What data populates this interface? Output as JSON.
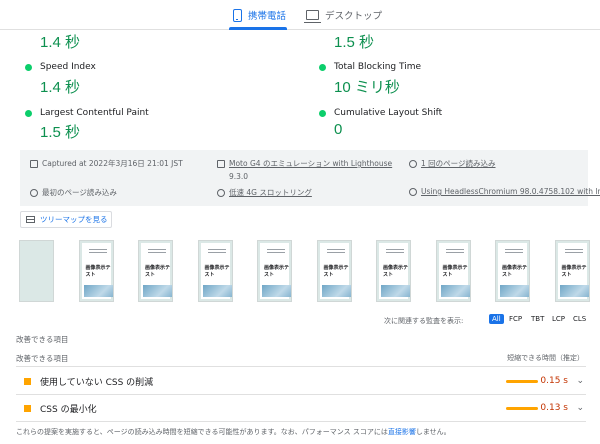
{
  "tabs": [
    {
      "label": "携帯電話",
      "icon": "mobile-phone-icon",
      "active": true
    },
    {
      "label": "デスクトップ",
      "icon": "desktop-icon",
      "active": false
    }
  ],
  "metrics": {
    "top_left_value": "1.4 秒",
    "top_right_value": "1.5 秒",
    "speed_index": {
      "label": "Speed Index",
      "value": "1.4 秒"
    },
    "total_blocking_time": {
      "label": "Total Blocking Time",
      "value": "10 ミリ秒"
    },
    "lcp": {
      "label": "Largest Contentful Paint",
      "value": "1.5 秒"
    },
    "cls": {
      "label": "Cumulative Layout Shift",
      "value": "0"
    }
  },
  "info": {
    "captured": "Captured at 2022年3月16日 21:01 JST",
    "device": "Moto G4 のエミュレーション with Lighthouse",
    "lighthouse_version": "9.3.0",
    "session": "1 回のページ読み込み",
    "initial_load": "最初のページ読み込み",
    "throttling": "低速 4G スロットリング",
    "browser": "Using HeadlessChromium 98.0.4758.102 with lr"
  },
  "treemap_button": "ツリーマップを見る",
  "filmstrip": {
    "frame_text": "画像表示テスト",
    "frame_count": 10
  },
  "audit_filter": {
    "label": "次に関連する監査を表示:",
    "chips": [
      "All",
      "FCP",
      "TBT",
      "LCP",
      "CLS"
    ],
    "active": "All"
  },
  "opportunities": {
    "header": "改善できる項目",
    "column_title": "改善できる項目",
    "column_savings": "短縮できる時間（推定）",
    "items": [
      {
        "title": "使用していない CSS の削減",
        "savings": "0.15 s"
      },
      {
        "title": "CSS の最小化",
        "savings": "0.13 s"
      }
    ]
  },
  "footnote": {
    "text": "これらの提案を実施すると、ページの読み込み時間を短縮できる可能性があります。なお、パフォーマンス スコアには",
    "link": "直接影響",
    "tail": "しません。"
  },
  "colors": {
    "pass": "#0cce6b",
    "pass_text": "#0d904f",
    "accent": "#1a73e8",
    "warn": "#ffa400"
  }
}
